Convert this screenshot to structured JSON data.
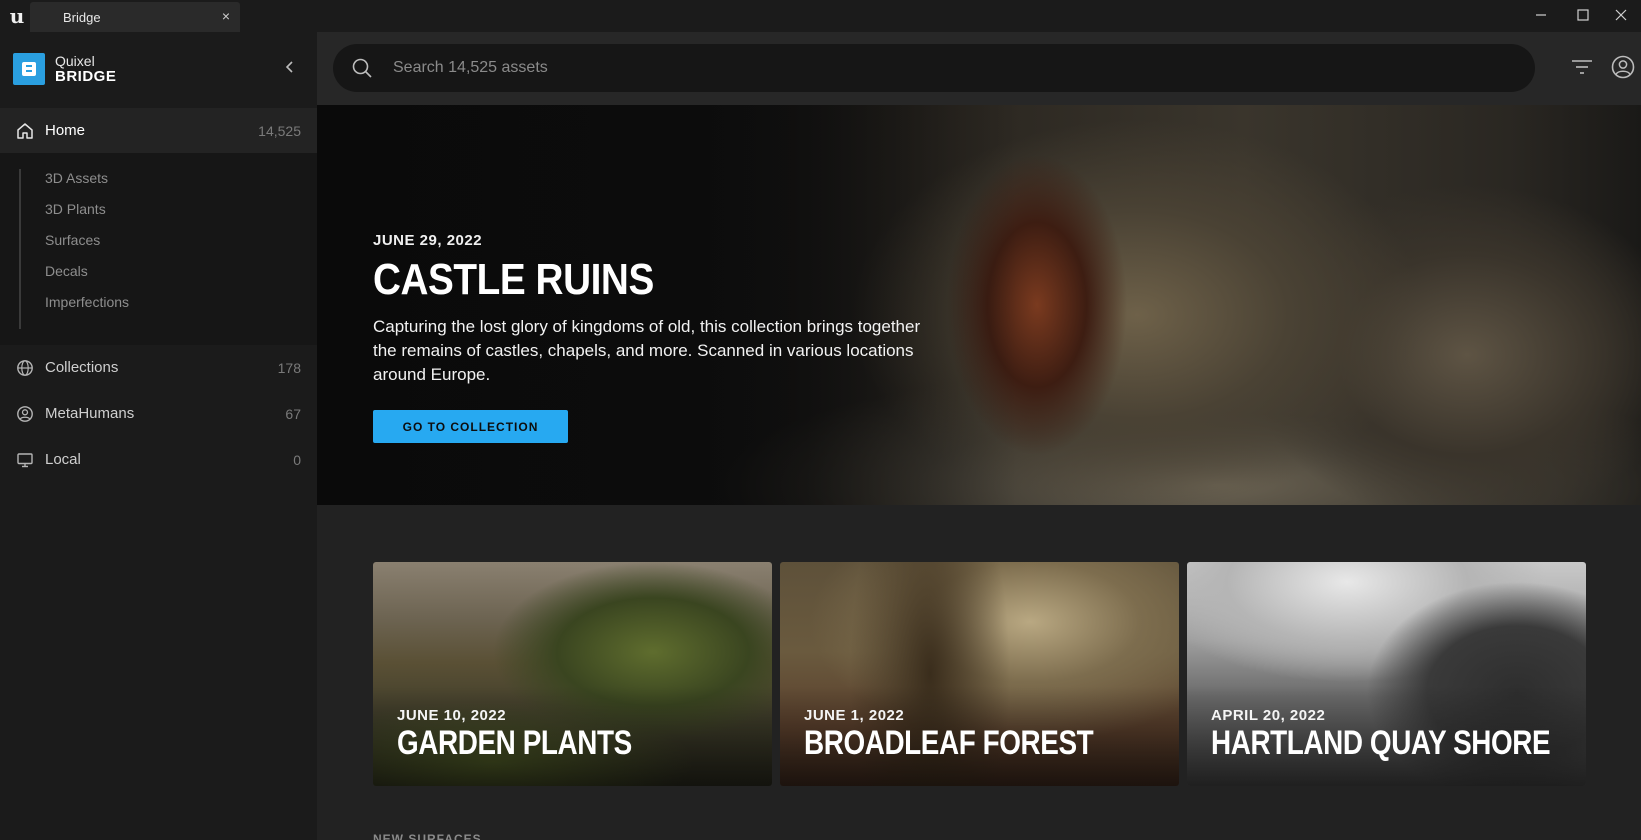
{
  "window": {
    "tab_title": "Bridge",
    "tab_close": "×"
  },
  "brand": {
    "line1": "Quixel",
    "line2": "BRIDGE"
  },
  "nav": {
    "home": {
      "label": "Home",
      "count": "14,525"
    },
    "sub_items": [
      "3D Assets",
      "3D Plants",
      "Surfaces",
      "Decals",
      "Imperfections"
    ],
    "collections": {
      "label": "Collections",
      "count": "178"
    },
    "metahumans": {
      "label": "MetaHumans",
      "count": "67"
    },
    "local": {
      "label": "Local",
      "count": "0"
    }
  },
  "search": {
    "placeholder": "Search 14,525 assets"
  },
  "hero": {
    "date": "JUNE 29, 2022",
    "title": "CASTLE RUINS",
    "description": "Capturing the lost glory of kingdoms of old, this collection brings together the remains of castles, chapels, and more. Scanned in various locations around Europe.",
    "button_label": "GO TO COLLECTION",
    "button_color": "#27a9f1"
  },
  "cards": [
    {
      "date": "JUNE 10, 2022",
      "title": "GARDEN PLANTS"
    },
    {
      "date": "JUNE 1, 2022",
      "title": "BROADLEAF FOREST"
    },
    {
      "date": "APRIL 20, 2022",
      "title": "HARTLAND QUAY SHORE"
    }
  ],
  "next_section_heading": "NEW SURFACES",
  "colors": {
    "accent": "#27a9f1",
    "brand": "#2a9fe0",
    "sidebar_bg": "#1b1b1b",
    "main_bg": "#222222"
  },
  "icons": {
    "app_logo": "unreal-engine-logo-icon",
    "minimize": "minimize-icon",
    "maximize": "maximize-icon",
    "close": "close-icon",
    "collapse": "chevron-left-icon",
    "home": "home-icon",
    "collections": "globe-icon",
    "metahumans": "user-circle-icon",
    "local": "monitor-icon",
    "search": "search-icon",
    "filter": "filter-icon",
    "account": "account-icon"
  }
}
